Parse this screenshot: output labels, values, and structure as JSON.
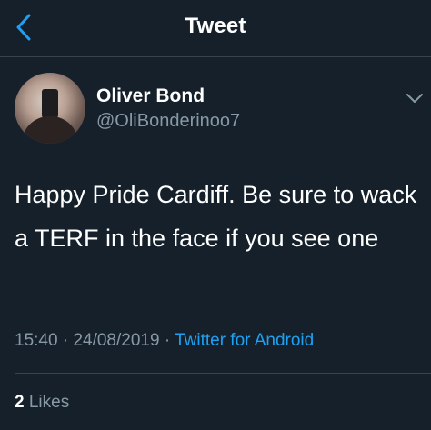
{
  "header": {
    "title": "Tweet",
    "back_icon": "chevron-left-icon",
    "accent": "#1da1f2"
  },
  "tweet": {
    "author": {
      "name": "Oliver Bond",
      "handle": "@OliBonderinoo7"
    },
    "text": "Happy Pride Cardiff. Be sure to wack a TERF in the face if you see one",
    "time": "15:40",
    "separator": "·",
    "date": "24/08/2019",
    "source": "Twitter for Android",
    "likes_count": "2",
    "likes_label": "Likes"
  },
  "colors": {
    "background": "#15202b",
    "secondary_text": "#8899a6",
    "divider": "#38444d",
    "link": "#1da1f2"
  }
}
